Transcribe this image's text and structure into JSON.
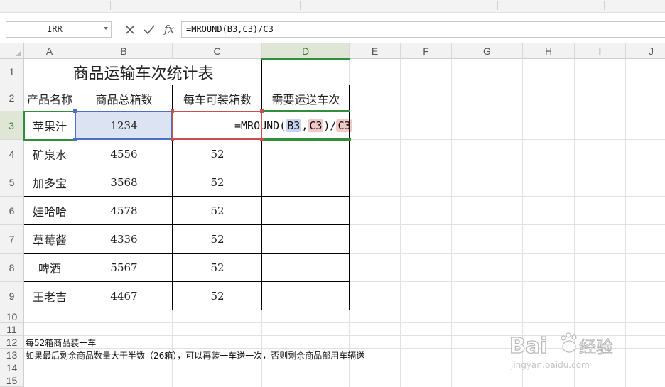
{
  "formula_bar": {
    "name_box": "IRR",
    "formula": "=MROUND(B3,C3)/C3",
    "fx_label": "fx"
  },
  "columns": [
    "A",
    "B",
    "C",
    "D",
    "E",
    "F",
    "G",
    "H",
    "I",
    "J"
  ],
  "rows": [
    "1",
    "2",
    "3",
    "4",
    "5",
    "6",
    "7",
    "8",
    "9",
    "10",
    "11",
    "12",
    "13",
    "14",
    "15"
  ],
  "sheet": {
    "title": "商品运输车次统计表",
    "headers": {
      "product": "产品名称",
      "total_boxes": "商品总箱数",
      "boxes_per_truck": "每车可装箱数",
      "trips_needed": "需要运送车次"
    },
    "items": [
      {
        "name": "苹果汁",
        "total": "1234",
        "per_truck": ""
      },
      {
        "name": "矿泉水",
        "total": "4556",
        "per_truck": "52"
      },
      {
        "name": "加多宝",
        "total": "3568",
        "per_truck": "52"
      },
      {
        "name": "娃哈哈",
        "total": "4578",
        "per_truck": "52"
      },
      {
        "name": "草莓酱",
        "total": "4336",
        "per_truck": "52"
      },
      {
        "name": "啤酒",
        "total": "5567",
        "per_truck": "52"
      },
      {
        "name": "王老吉",
        "total": "4467",
        "per_truck": "52"
      }
    ],
    "editing_formula": {
      "prefix": "=MROUND(",
      "ref1": "B3",
      "sep": ",",
      "ref2": "C3",
      "mid": ")/",
      "ref3": "C3"
    },
    "note1": "每52箱商品装一车",
    "note2": "如果最后剩余商品数量大于半数（26箱），可以再装一车送一次，否则剩余商品部用车辆送"
  },
  "watermark": {
    "brand": "Bai",
    "brand2": "经验",
    "url": "jingyan.baidu.com"
  },
  "colors": {
    "selection_green": "#2f8f3a",
    "ref_blue": "#4f6fc2",
    "ref_red": "#c84f4f"
  }
}
